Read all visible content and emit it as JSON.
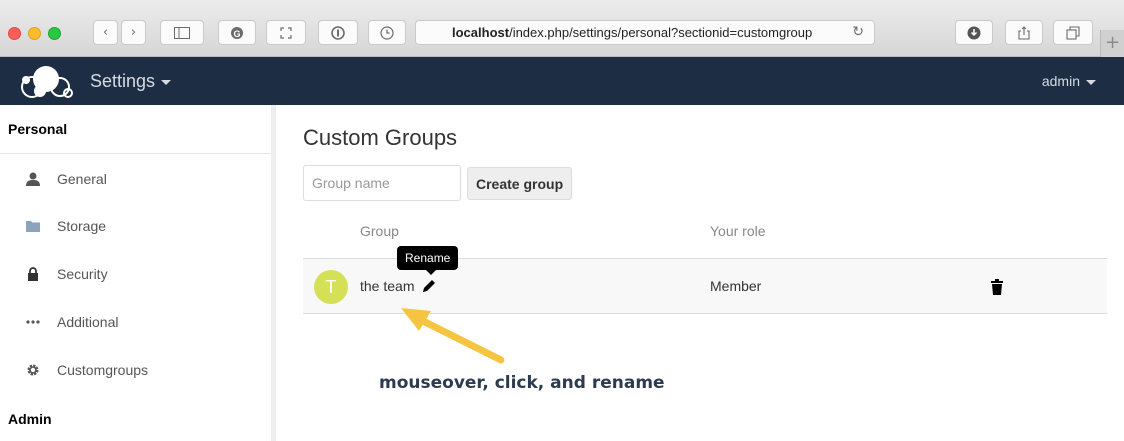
{
  "browser": {
    "url_host": "localhost",
    "url_path": "/index.php/settings/personal?sectionid=customgroup",
    "new_tab_label": "+"
  },
  "header": {
    "app_title": "Settings",
    "user": "admin"
  },
  "sidebar": {
    "personal_heading": "Personal",
    "items": [
      {
        "label": "General",
        "icon": "person-icon"
      },
      {
        "label": "Storage",
        "icon": "folder-icon"
      },
      {
        "label": "Security",
        "icon": "lock-icon"
      },
      {
        "label": "Additional",
        "icon": "more-icon"
      },
      {
        "label": "Customgroups",
        "icon": "gear-icon"
      }
    ],
    "admin_heading": "Admin"
  },
  "main": {
    "title": "Custom Groups",
    "group_name_placeholder": "Group name",
    "create_button": "Create group",
    "columns": {
      "group": "Group",
      "role": "Your role"
    },
    "rows": [
      {
        "avatar_letter": "T",
        "name": "the team",
        "role": "Member"
      }
    ],
    "tooltip": "Rename",
    "annotation": "mouseover, click, and rename"
  },
  "colors": {
    "header_bg": "#1d2d44",
    "avatar": "#d4e157",
    "annotation_arrow": "#f5c542"
  }
}
